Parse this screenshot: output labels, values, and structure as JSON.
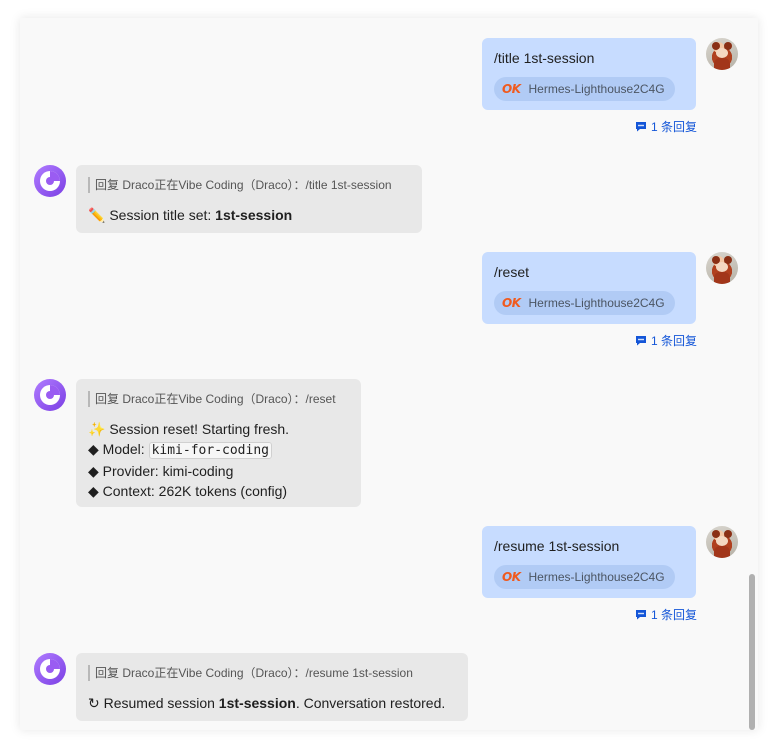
{
  "conversation": {
    "messages": [
      {
        "role": "user",
        "command": "/title 1st-session",
        "chip": {
          "badge": "OK",
          "label": "Hermes-Lighthouse2C4G"
        },
        "reply_link": "1 条回复"
      },
      {
        "role": "bot",
        "quote": "回复 Draco正在Vibe Coding（Draco）：/title 1st-session",
        "line1_prefix": "✏️ Session title set: ",
        "line1_bold": "1st-session"
      },
      {
        "role": "user",
        "command": "/reset",
        "chip": {
          "badge": "OK",
          "label": "Hermes-Lighthouse2C4G"
        },
        "reply_link": "1 条回复"
      },
      {
        "role": "bot",
        "quote": "回复 Draco正在Vibe Coding（Draco）：/reset",
        "line1": "✨ Session reset! Starting fresh.",
        "model_label": "◆ Model: ",
        "model_value": "kimi-for-coding",
        "provider": "◆ Provider: kimi-coding",
        "context": "◆ Context: 262K tokens (config)"
      },
      {
        "role": "user",
        "command": "/resume 1st-session",
        "chip": {
          "badge": "OK",
          "label": "Hermes-Lighthouse2C4G"
        },
        "reply_link": "1 条回复"
      },
      {
        "role": "bot",
        "quote": "回复 Draco正在Vibe Coding（Draco）：/resume 1st-session",
        "line1_prefix": "↻ Resumed session ",
        "line1_bold": "1st-session",
        "line1_suffix": ". Conversation restored."
      }
    ]
  },
  "colors": {
    "user_bubble": "#c7dcff",
    "bot_bubble": "#e8e8e8",
    "link": "#1456d8",
    "ok_badge": "#f05a1e"
  },
  "icons": {
    "user_avatar": "red-panda-avatar-icon",
    "bot_avatar": "purple-app-logo-icon",
    "reply": "comment-icon"
  }
}
